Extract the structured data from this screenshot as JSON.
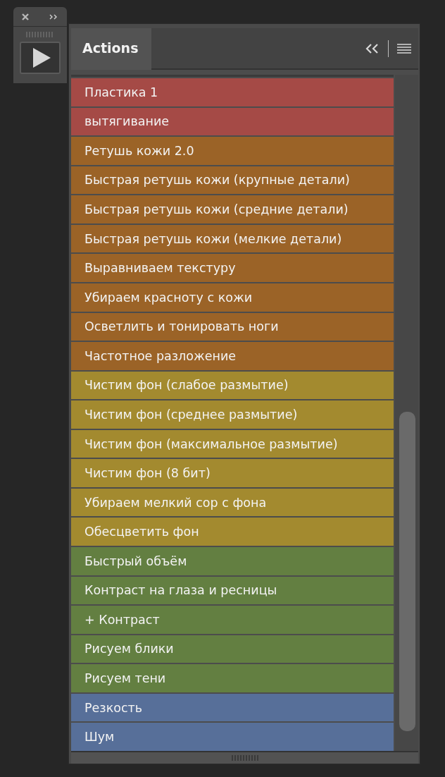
{
  "panel": {
    "title": "Actions",
    "selected": true
  },
  "actions": [
    {
      "label": "Пластика 1",
      "color": "#a54a46"
    },
    {
      "label": "вытягивание",
      "color": "#a54a46"
    },
    {
      "label": "Ретушь кожи 2.0",
      "color": "#9b6327"
    },
    {
      "label": "Быстрая ретушь кожи (крупные детали)",
      "color": "#9b6327"
    },
    {
      "label": "Быстрая ретушь кожи (средние детали)",
      "color": "#9b6327"
    },
    {
      "label": "Быстрая ретушь кожи (мелкие детали)",
      "color": "#9b6327"
    },
    {
      "label": "Выравниваем текстуру",
      "color": "#9b6327"
    },
    {
      "label": "Убираем красноту с кожи",
      "color": "#9b6327"
    },
    {
      "label": "Осветлить и тонировать ноги",
      "color": "#9b6327"
    },
    {
      "label": "Частотное разложение",
      "color": "#9b6327"
    },
    {
      "label": "Чистим фон (слабое размытие)",
      "color": "#a38a2f"
    },
    {
      "label": "Чистим фон (среднее размытие)",
      "color": "#a38a2f"
    },
    {
      "label": "Чистим фон (максимальное размытие)",
      "color": "#a38a2f"
    },
    {
      "label": "Чистим фон (8 бит)",
      "color": "#a38a2f"
    },
    {
      "label": "Убираем мелкий сор с фона",
      "color": "#a38a2f"
    },
    {
      "label": "Обесцветить фон",
      "color": "#a38a2f"
    },
    {
      "label": "Быстрый объём",
      "color": "#637f41"
    },
    {
      "label": "Контраст на глаза и ресницы",
      "color": "#637f41"
    },
    {
      "label": "+ Контраст",
      "color": "#637f41"
    },
    {
      "label": "Рисуем блики",
      "color": "#637f41"
    },
    {
      "label": "Рисуем тени",
      "color": "#637f41"
    },
    {
      "label": "Резкость",
      "color": "#576f99"
    },
    {
      "label": "Шум",
      "color": "#576f99"
    }
  ]
}
